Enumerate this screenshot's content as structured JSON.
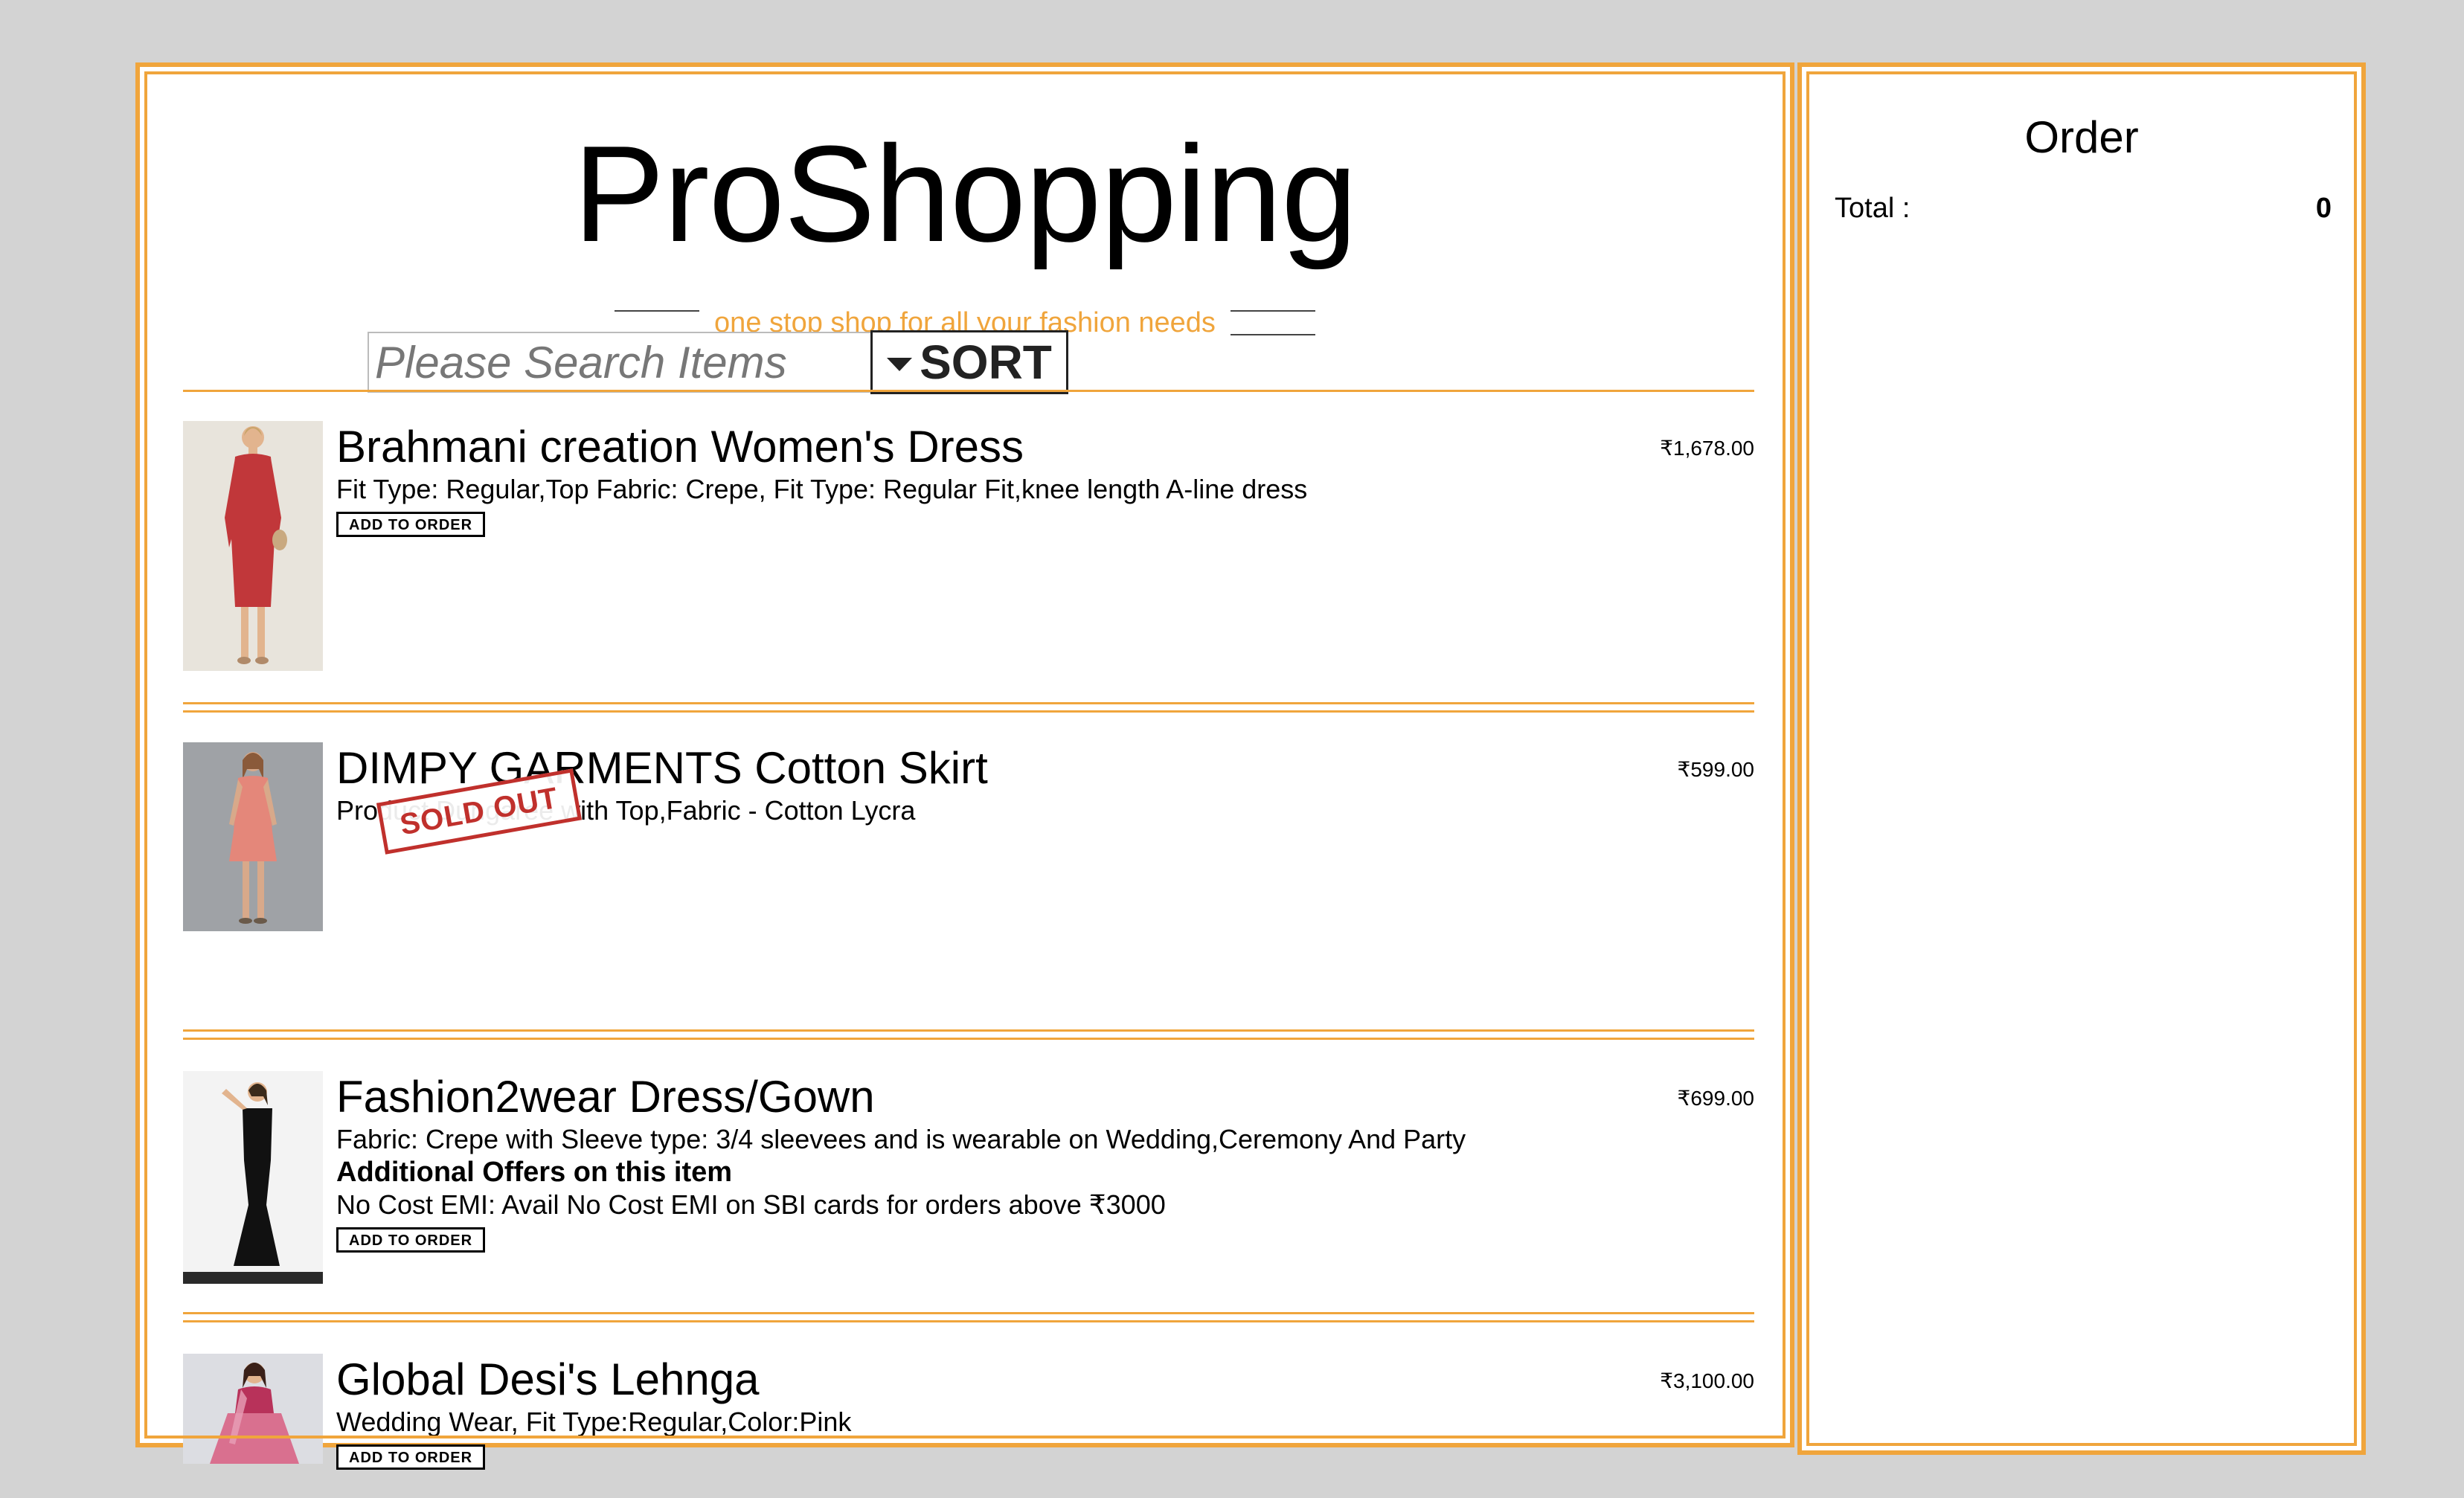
{
  "brand": {
    "title": "ProShopping",
    "tagline": "one stop shop for all your fashion needs"
  },
  "search": {
    "placeholder": "Please Search Items",
    "sort_label": "SORT"
  },
  "currency_symbol": "₹",
  "colors": {
    "accent": "#f0a53c",
    "sold_out": "#c0302c",
    "page_background": "#d3d3d3"
  },
  "items": [
    {
      "name": "Brahmani creation Women's Dress",
      "desc": "Fit Type: Regular,Top Fabric: Crepe, Fit Type: Regular Fit,knee length A-line dress",
      "price": "₹1,678.00",
      "button": "ADD TO ORDER",
      "image": "red-dress-model"
    },
    {
      "name": "DIMPY GARMENTS Cotton Skirt",
      "desc": "Product Dungaree with Top,Fabric - Cotton Lycra",
      "price": "₹599.00",
      "badge": "SOLD OUT",
      "image": "pink-dress-model"
    },
    {
      "name": "Fashion2wear Dress/Gown",
      "desc": "Fabric: Crepe with Sleeve type: 3/4 sleevees and is wearable on Wedding,Ceremony And Party",
      "offer_title": "Additional Offers on this item",
      "offer_text": "No Cost EMI: Avail No Cost EMI on SBI cards for orders above ₹3000",
      "price": "₹699.00",
      "button": "ADD TO ORDER",
      "image": "black-gown-model"
    },
    {
      "name": "Global Desi's Lehnga",
      "desc": "Wedding Wear, Fit Type:Regular,Color:Pink",
      "price": "₹3,100.00",
      "button": "ADD TO ORDER",
      "image": "pink-lehnga-model"
    }
  ],
  "order": {
    "title": "Order",
    "total_label": "Total :",
    "total_value": "0"
  }
}
